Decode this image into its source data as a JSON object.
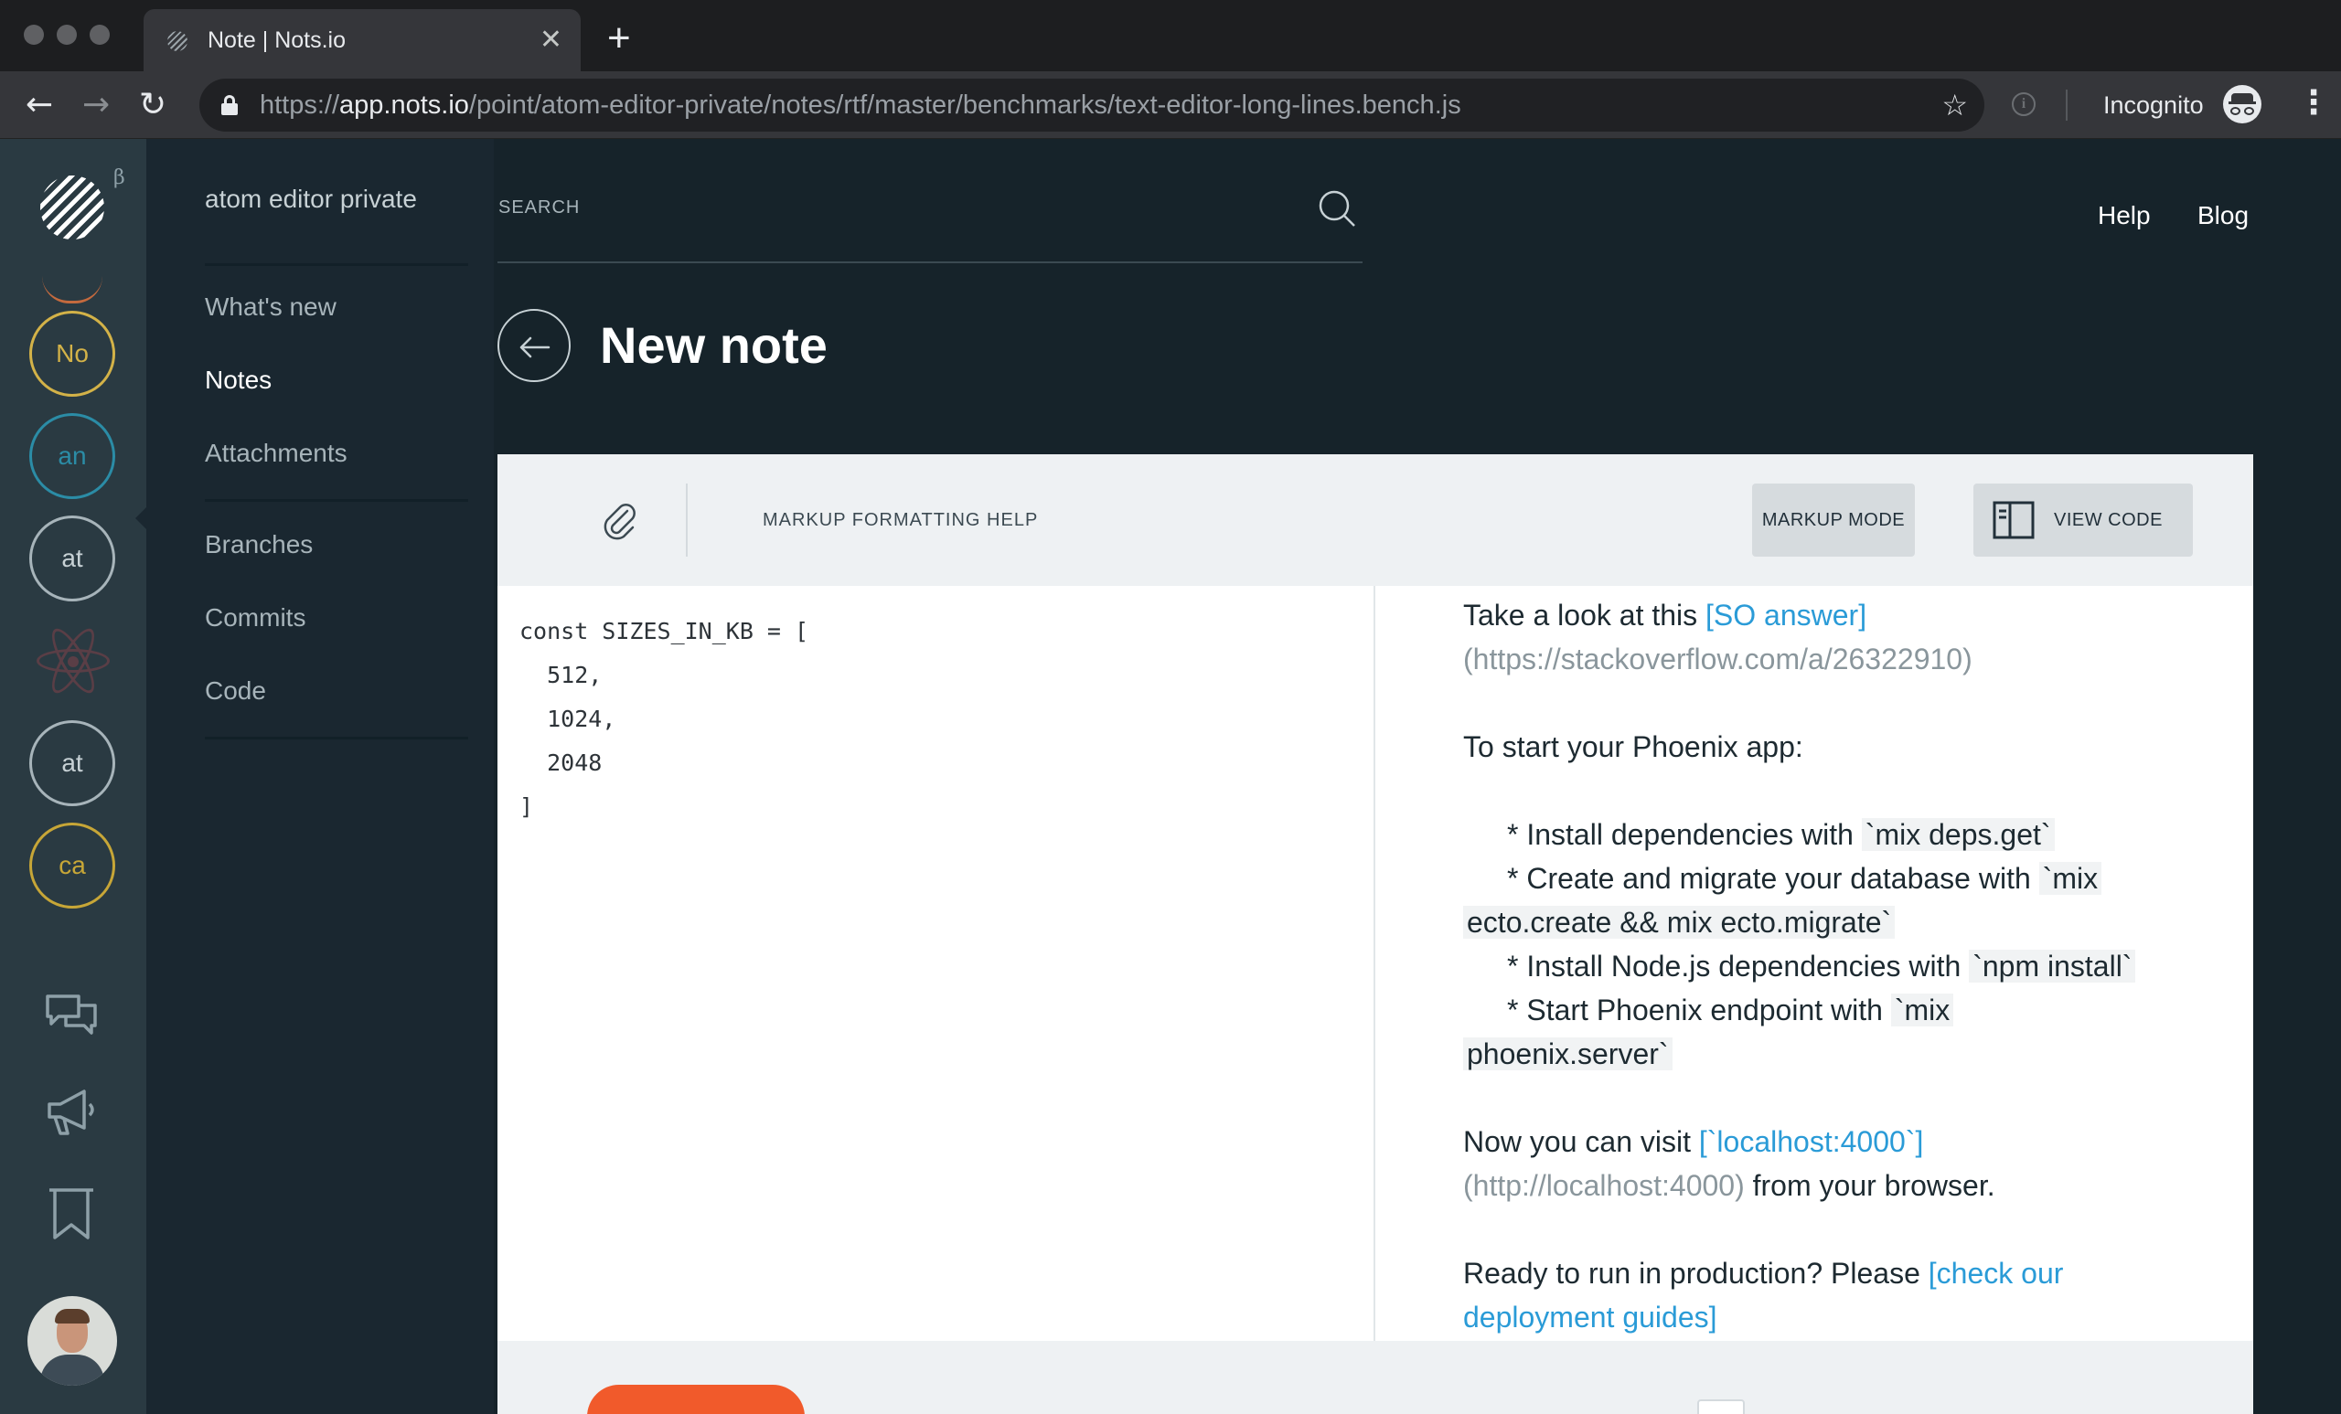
{
  "browser": {
    "tab_title": "Note | Nots.io",
    "tab_close": "✕",
    "new_tab": "+",
    "url_scheme": "https://",
    "url_host": "app.nots.io",
    "url_path": "/point/atom-editor-private/notes/rtf/master/benchmarks/text-editor-long-lines.bench.js",
    "incognito_label": "Incognito",
    "icons": {
      "back": "←",
      "forward": "→",
      "reload": "↻",
      "star": "☆",
      "info": "i",
      "menu": "⋮"
    }
  },
  "rail": {
    "beta": "β",
    "projects": [
      {
        "label": "No",
        "color": "#d3b248"
      },
      {
        "label": "an",
        "color": "#2b8ca6"
      },
      {
        "label": "at",
        "color": "#a7b4ba"
      },
      {
        "label": "at",
        "color": "#a7b4ba"
      },
      {
        "label": "ca",
        "color": "#c7a637"
      }
    ]
  },
  "nav": {
    "project_name": "atom editor private",
    "items_top": [
      "What's new",
      "Notes",
      "Attachments"
    ],
    "items_bottom": [
      "Branches",
      "Commits",
      "Code"
    ],
    "active": "Notes"
  },
  "header": {
    "search_placeholder": "SEARCH",
    "help": "Help",
    "blog": "Blog"
  },
  "page": {
    "title": "New note"
  },
  "editor": {
    "format_help": "MARKUP FORMATTING HELP",
    "markup_mode": "MARKUP MODE",
    "view_code": "VIEW CODE",
    "code_lines": [
      "const SIZES_IN_KB = [",
      "  512,",
      "  1024,",
      "  2048",
      "]"
    ]
  },
  "preview": {
    "p1_text": "Take a look at this ",
    "p1_link": "[SO answer]",
    "p1_url": "(https://stackoverflow.com/a/26322910)",
    "p2": "To start your Phoenix app:",
    "b1_text": "* Install dependencies with ",
    "b1_code": "`mix deps.get`",
    "b2_text": "* Create and migrate your database with ",
    "b2_code_a": "`mix",
    "b2_code_b": "ecto.create && mix ecto.migrate`",
    "b3_text": "* Install Node.js dependencies with ",
    "b3_code": "`npm install`",
    "b4_text": "* Start Phoenix endpoint with ",
    "b4_code_a": "`mix",
    "b4_code_b": "phoenix.server`",
    "p3_text": "Now you can visit ",
    "p3_link": "[`localhost:4000`]",
    "p3_url": "(http://localhost:4000)",
    "p3_tail": " from your browser.",
    "p4_text": "Ready to run in production? Please ",
    "p4_link": "[check our deployment guides]"
  },
  "colors": {
    "rail": "#2a3a42",
    "nav": "#1a2730",
    "main": "#16232a",
    "link": "#2a9bd7",
    "accent": "#f15a2b"
  }
}
